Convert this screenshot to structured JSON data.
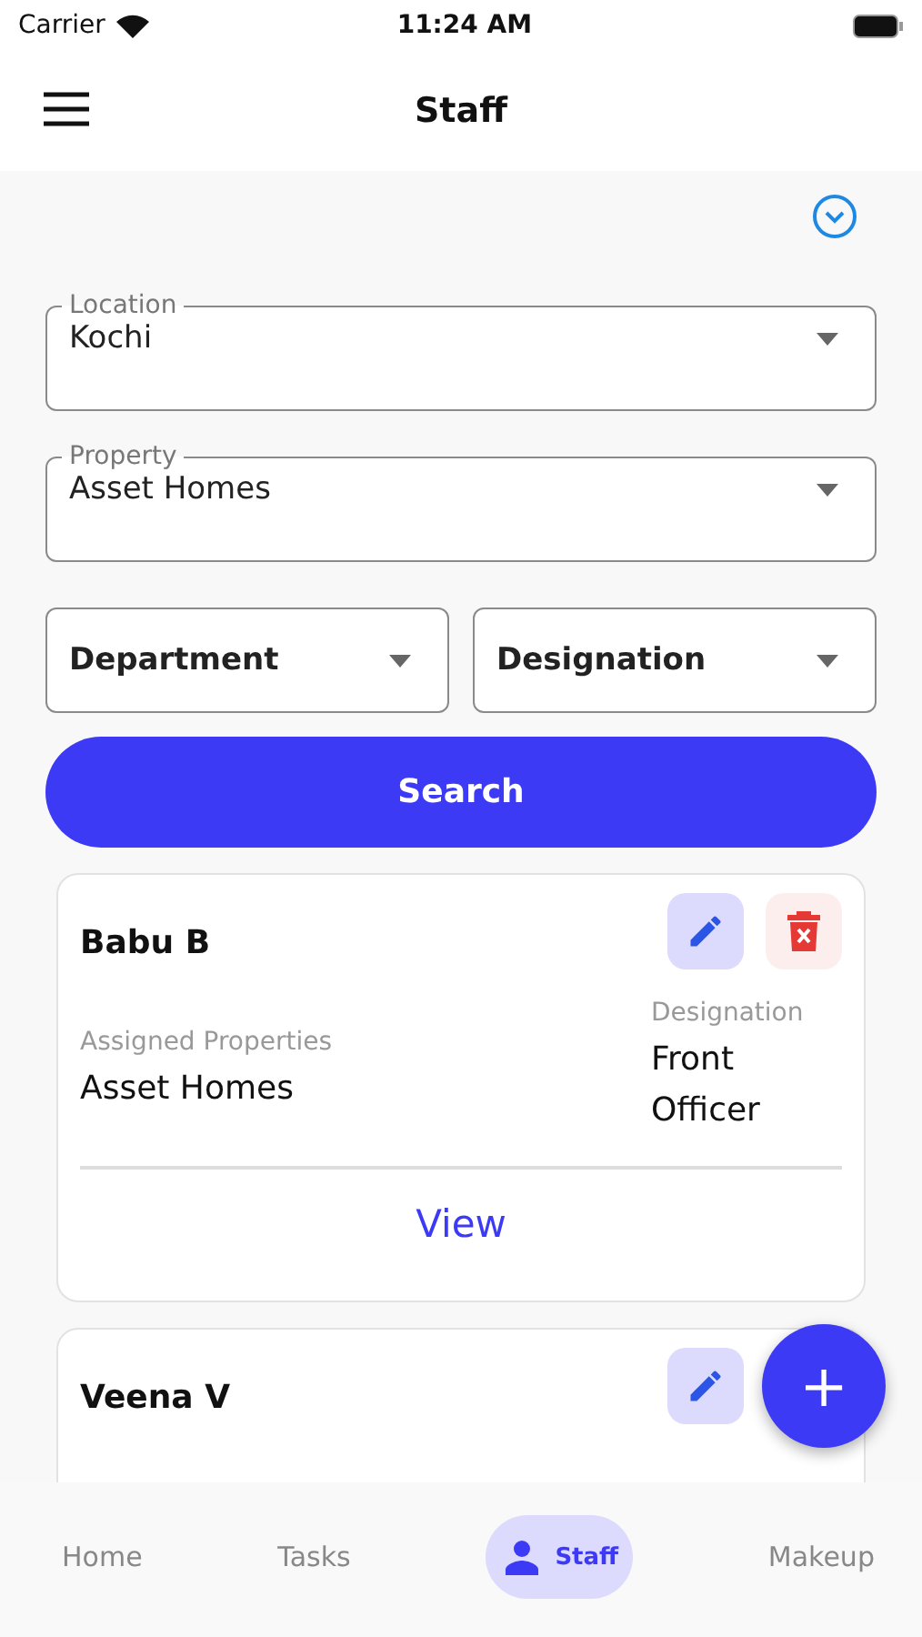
{
  "status_bar": {
    "carrier": "Carrier",
    "time": "11:24 AM"
  },
  "header": {
    "title": "Staff"
  },
  "filters": {
    "location": {
      "label": "Location",
      "value": "Kochi"
    },
    "property": {
      "label": "Property",
      "value": "Asset Homes"
    },
    "department": {
      "placeholder": "Department"
    },
    "designation": {
      "placeholder": "Designation"
    },
    "search_button": "Search"
  },
  "staff": [
    {
      "name": "Babu B",
      "actions": [
        {
          "kind": "edit"
        },
        {
          "kind": "delete"
        }
      ],
      "assigned_label": "Assigned Properties",
      "assigned": "Asset Homes",
      "designation_label": "Designation",
      "designation": "Front Officer",
      "view": "View"
    },
    {
      "name": "Veena V",
      "actions": [
        {
          "kind": "edit"
        }
      ]
    }
  ],
  "fab": "+",
  "nav": [
    {
      "label": "Home",
      "selected": false
    },
    {
      "label": "Tasks",
      "selected": false
    },
    {
      "label": "Staff",
      "selected": true
    },
    {
      "label": "Makeup",
      "selected": false
    }
  ]
}
